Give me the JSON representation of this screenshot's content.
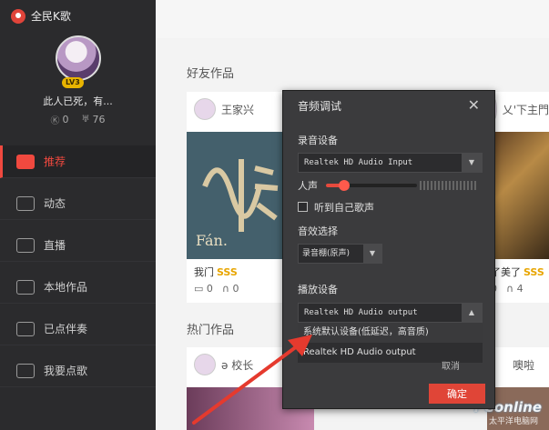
{
  "app": {
    "title": "全民K歌"
  },
  "profile": {
    "name": "此人已死，有...",
    "level": "LV3",
    "followers": "0",
    "gifts": "76"
  },
  "nav": {
    "items": [
      {
        "label": "推荐"
      },
      {
        "label": "动态"
      },
      {
        "label": "直播"
      },
      {
        "label": "本地作品"
      },
      {
        "label": "已点伴奏"
      },
      {
        "label": "我要点歌"
      }
    ]
  },
  "main": {
    "friends_title": "好友作品",
    "hot_title": "热门作品",
    "cards": [
      {
        "user": "王家兴",
        "song": "我门",
        "rating": "SSS",
        "comments": "0",
        "listens": "0",
        "cover_text": "Fán."
      },
      {
        "user": "乂'下主門",
        "song": "了美了",
        "rating": "SSS",
        "comments": "0",
        "listens": "4"
      }
    ],
    "hot_cards": [
      {
        "user": "ə 校长"
      },
      {
        "user": "噢啦"
      }
    ]
  },
  "dialog": {
    "title": "音频调试",
    "record_device_label": "录音设备",
    "record_device_value": "Realtek HD Audio Input",
    "vocal_label": "人声",
    "vocal_level": 0.2,
    "hear_self_label": "听到自己歌声",
    "effect_label": "音效选择",
    "effect_value": "录音棚(原声)",
    "playback_label": "播放设备",
    "playback_value": "Realtek HD Audio output",
    "playback_options": [
      "系统默认设备(低延迟，高音质)",
      "Realtek HD Audio output"
    ],
    "ok_label": "确定",
    "cancel_label": "取消"
  },
  "watermark": {
    "text": "PConline",
    "sub": "太平洋电脑网"
  },
  "colors": {
    "accent": "#e64a3d",
    "sidebar": "#2b2b2d",
    "dialog": "#3b3b3d",
    "annotation_arrow": "#e53a2e"
  }
}
